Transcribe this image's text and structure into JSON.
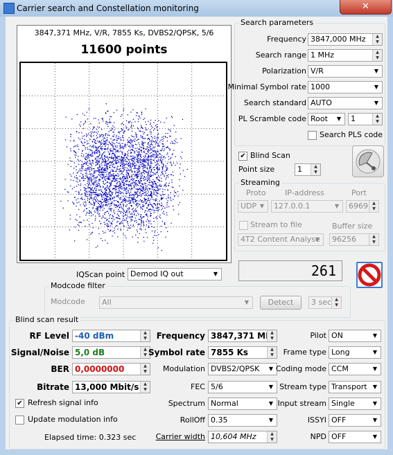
{
  "window": {
    "title": "Carrier search and Constellation monitoring",
    "close_label": "✕"
  },
  "plot": {
    "info_line": "3847,371 MHz, V/R, 7855 Ks, DVBS2/QPSK, 5/6",
    "points_label": "11600 points",
    "point_color": "#0000c0"
  },
  "iqscan": {
    "label": "IQScan point",
    "value": "Demod IQ out"
  },
  "modcode_filter": {
    "title": "Modcode filter",
    "modcode_label": "Modcode",
    "modcode_value": "All",
    "detect_label": "Detect",
    "interval_value": "3 sec"
  },
  "search_parameters": {
    "title": "Search parameters",
    "frequency_label": "Frequency",
    "frequency_value": "3847,000 MHz",
    "search_range_label": "Search range",
    "search_range_value": "1 MHz",
    "polarization_label": "Polarization",
    "polarization_value": "V/R",
    "min_symbol_rate_label": "Minimal Symbol rate",
    "min_symbol_rate_value": "1000",
    "search_standard_label": "Search standard",
    "search_standard_value": "AUTO",
    "pl_scramble_label": "PL Scramble code",
    "pl_scramble_type": "Root",
    "pl_scramble_value": "1",
    "search_pls_label": "Search PLS code"
  },
  "blind_scan": {
    "label": "Blind Scan",
    "checked": true,
    "point_size_label": "Point size",
    "point_size_value": "1"
  },
  "streaming": {
    "title": "Streaming",
    "proto_label": "Proto",
    "ip_label": "IP-address",
    "port_label": "Port",
    "proto_value": "UDP",
    "ip_value": "127.0.0.1",
    "port_value": "6969",
    "stream_to_file_label": "Stream to file",
    "buffer_size_label": "Buffer size",
    "file_type_value": "4T2 Content Analyse",
    "buffer_size_value": "96256"
  },
  "readout_value": "261",
  "result": {
    "title": "Blind scan result",
    "rf_level_label": "RF Level",
    "rf_level_value": "-40 dBm",
    "rf_level_color": "#1a5fb4",
    "snr_label": "Signal/Noise",
    "snr_value": "5,0 dB",
    "snr_color": "#1e7d1e",
    "ber_label": "BER",
    "ber_value": "0,0000000",
    "ber_color": "#d01010",
    "bitrate_label": "Bitrate",
    "bitrate_value": "13,000 Mbit/s",
    "refresh_label": "Refresh signal info",
    "update_label": "Update modulation info",
    "elapsed_label": "Elapsed time: 0.323 sec",
    "frequency_label": "Frequency",
    "frequency_value": "3847,371 MHz",
    "symbol_rate_label": "Symbol rate",
    "symbol_rate_value": "7855 Ks",
    "modulation_label": "Modulation",
    "modulation_value": "DVBS2/QPSK",
    "fec_label": "FEC",
    "fec_value": "5/6",
    "spectrum_label": "Spectrum",
    "spectrum_value": "Normal",
    "rolloff_label": "RollOff",
    "rolloff_value": "0.35",
    "carrier_width_label": "Carrier width",
    "carrier_width_value": "10,604 MHz",
    "pilot_label": "Pilot",
    "pilot_value": "ON",
    "frame_type_label": "Frame type",
    "frame_type_value": "Long",
    "coding_mode_label": "Coding mode",
    "coding_mode_value": "CCM",
    "stream_type_label": "Stream type",
    "stream_type_value": "Transport",
    "input_stream_label": "Input stream",
    "input_stream_value": "Single",
    "issyi_label": "ISSYI",
    "issyi_value": "OFF",
    "npd_label": "NPD",
    "npd_value": "OFF"
  }
}
